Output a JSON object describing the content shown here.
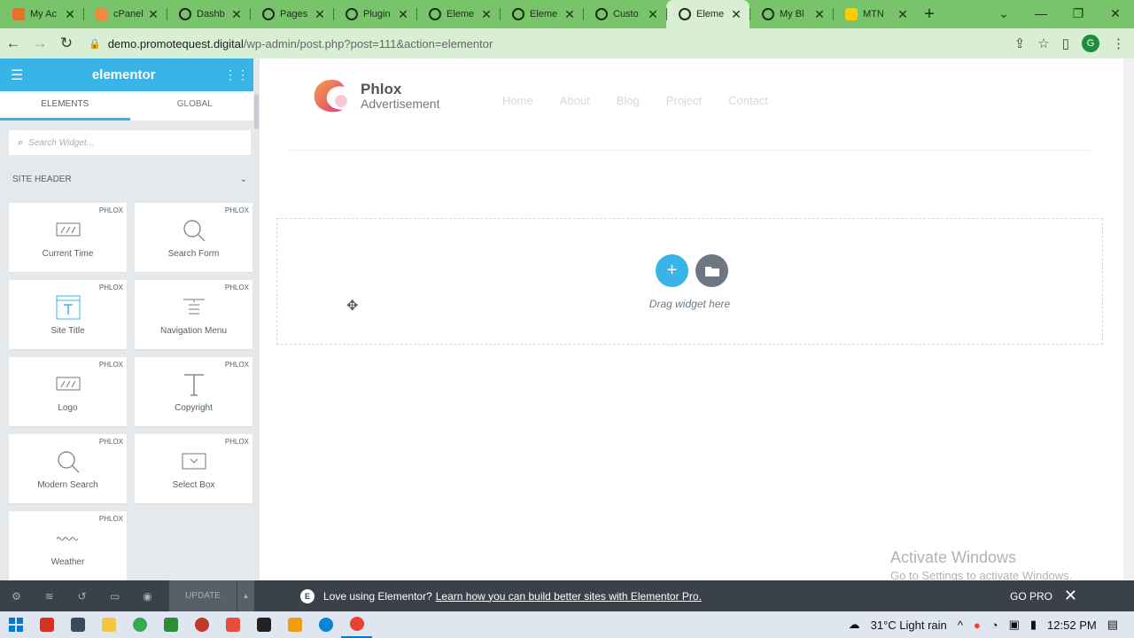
{
  "browser": {
    "tabs": [
      {
        "title": "My Ac",
        "active": false
      },
      {
        "title": "cPanel",
        "active": false
      },
      {
        "title": "Dashb",
        "active": false
      },
      {
        "title": "Pages",
        "active": false
      },
      {
        "title": "Plugin",
        "active": false
      },
      {
        "title": "Eleme",
        "active": false
      },
      {
        "title": "Eleme",
        "active": false
      },
      {
        "title": "Custo",
        "active": false
      },
      {
        "title": "Eleme",
        "active": true
      },
      {
        "title": "My Bl",
        "active": false
      },
      {
        "title": "MTN",
        "active": false
      }
    ],
    "url_host": "demo.promotequest.digital",
    "url_path": "/wp-admin/post.php?post=111&action=elementor",
    "profile_initial": "G"
  },
  "panel": {
    "brand": "elementor",
    "tabs": [
      "ELEMENTS",
      "GLOBAL"
    ],
    "search_placeholder": "Search Widget...",
    "category": "SITE HEADER",
    "widgets": [
      {
        "label": "Current Time",
        "badge": "PHLOX",
        "icon": "clock-box-icon"
      },
      {
        "label": "Search Form",
        "badge": "PHLOX",
        "icon": "search-icon"
      },
      {
        "label": "Site Title",
        "badge": "PHLOX",
        "icon": "title-icon"
      },
      {
        "label": "Navigation Menu",
        "badge": "PHLOX",
        "icon": "nav-menu-icon"
      },
      {
        "label": "Logo",
        "badge": "PHLOX",
        "icon": "logo-box-icon"
      },
      {
        "label": "Copyright",
        "badge": "PHLOX",
        "icon": "text-t-icon"
      },
      {
        "label": "Modern Search",
        "badge": "PHLOX",
        "icon": "search-icon"
      },
      {
        "label": "Select Box",
        "badge": "PHLOX",
        "icon": "select-box-icon"
      },
      {
        "label": "Weather",
        "badge": "PHLOX",
        "icon": "wave-icon"
      }
    ],
    "update_label": "UPDATE"
  },
  "site": {
    "brand_name": "Phlox",
    "brand_sub": "Advertisement",
    "menu": [
      "Home",
      "About",
      "Blog",
      "Project",
      "Contact"
    ]
  },
  "dropzone": {
    "text": "Drag widget here"
  },
  "promo": {
    "text": "Love using Elementor?",
    "link": "Learn how you can build better sites with Elementor Pro.",
    "cta": "GO PRO"
  },
  "watermark": {
    "line1": "Activate Windows",
    "line2": "Go to Settings to activate Windows."
  },
  "taskbar": {
    "weather": "31°C  Light rain",
    "time": "12:52 PM"
  },
  "colors": {
    "accent": "#39b4e8",
    "tabbar": "#77c46b",
    "panel_bg": "#e6e9ec",
    "footer": "#3a4148"
  }
}
